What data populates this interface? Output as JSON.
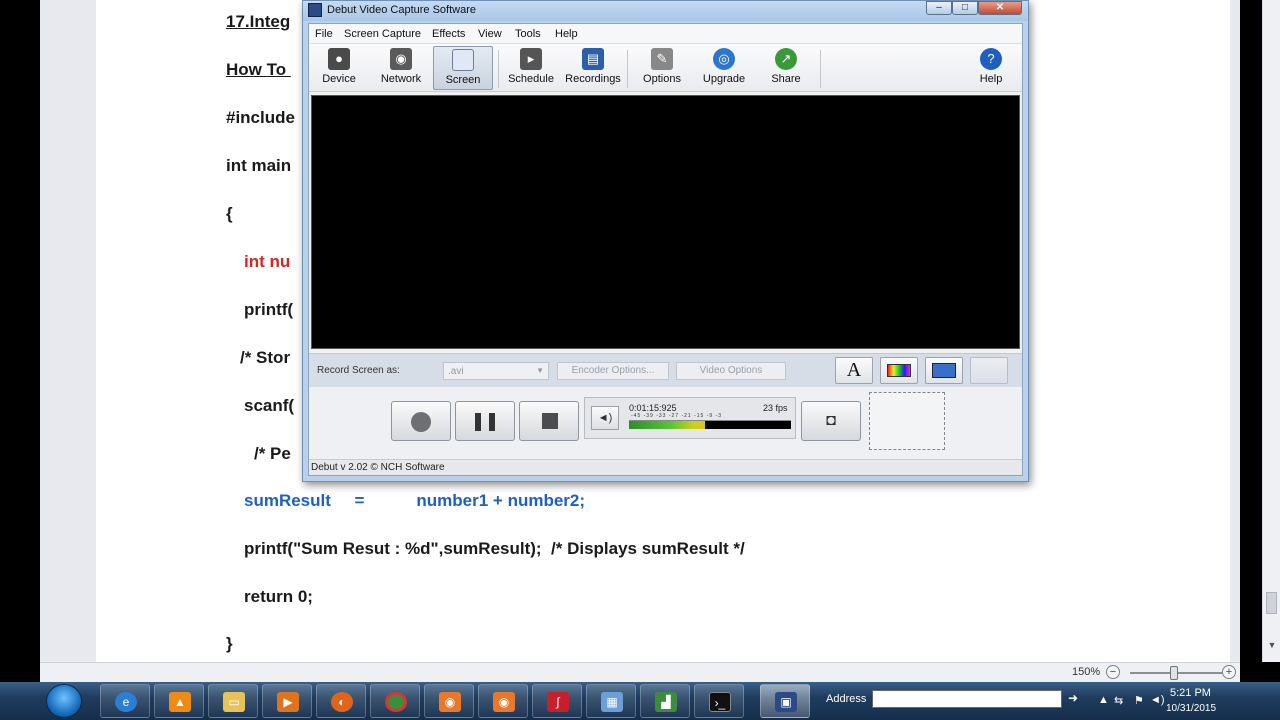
{
  "doc": {
    "lines": [
      {
        "text": "17.Integ",
        "style": "heading"
      },
      {
        "text": "How To ",
        "style": "heading"
      },
      {
        "text": "#include",
        "style": "normal"
      },
      {
        "text": "int main",
        "style": "normal"
      },
      {
        "text": "{",
        "style": "normal"
      },
      {
        "text": "int nu",
        "style": "red"
      },
      {
        "text": "printf(",
        "style": "normal"
      },
      {
        "text": "/* Stor",
        "style": "normal"
      },
      {
        "text": "scanf(",
        "style": "normal"
      },
      {
        "text": "/* Pe",
        "style": "normal"
      },
      {
        "text": "sumResult     =           number1 + number2;",
        "style": "blue"
      },
      {
        "text": "printf(\"Sum Resut : %d\",sumResult);  /* Displays sumResult */",
        "style": "normal"
      },
      {
        "text": "return 0;",
        "style": "normal"
      },
      {
        "text": "}",
        "style": "normal"
      }
    ],
    "zoom": "150%"
  },
  "debut": {
    "title": "Debut Video Capture Software",
    "menu": [
      "File",
      "Screen Capture",
      "Effects",
      "View",
      "Tools",
      "Help"
    ],
    "toolbar": [
      {
        "label": "Device",
        "icon": "webcam-icon",
        "color": "#4a4a4a"
      },
      {
        "label": "Network",
        "icon": "network-camera-icon",
        "color": "#5a5a5a"
      },
      {
        "label": "Screen",
        "icon": "screen-icon",
        "color": "#dfe8f4",
        "active": true
      },
      {
        "label": "Schedule",
        "icon": "schedule-icon",
        "color": "#555"
      },
      {
        "label": "Recordings",
        "icon": "recordings-icon",
        "color": "#2d5fa8"
      },
      {
        "label": "Options",
        "icon": "options-icon",
        "color": "#888"
      },
      {
        "label": "Upgrade",
        "icon": "upgrade-icon",
        "color": "#2d77c8"
      },
      {
        "label": "Share",
        "icon": "share-icon",
        "color": "#3a9a3a"
      },
      {
        "label": "Help",
        "icon": "help-icon",
        "color": "#1f5fbf"
      }
    ],
    "record_label": "Record Screen as:",
    "format": ".avi",
    "encoder_options": "Encoder Options...",
    "video_options": "Video Options",
    "timecode": "0:01:15:925",
    "fps": "23 fps",
    "meter_ticks": "-45 -39 -33 -27 -21 -15 -9 -3",
    "audio_level": 0.47,
    "status": "Debut v 2.02 © NCH Software"
  },
  "taskbar": {
    "address_label": "Address",
    "address_value": "",
    "clock_time": "5:21 PM",
    "clock_date": "10/31/2015"
  }
}
